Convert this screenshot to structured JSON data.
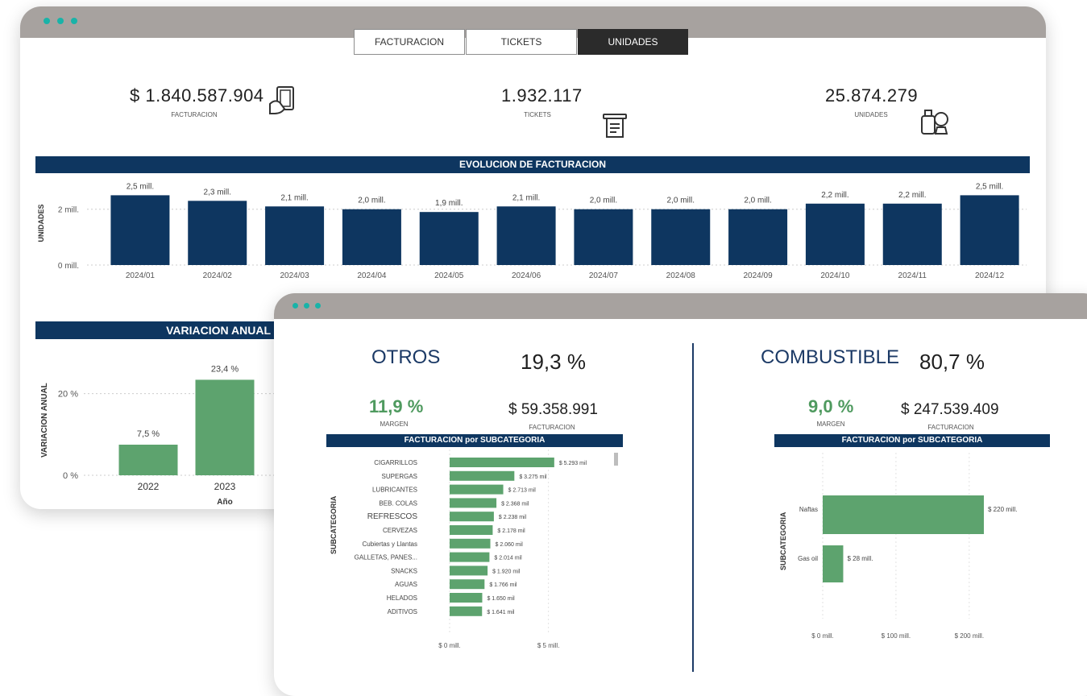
{
  "back_window": {
    "tabs": [
      {
        "label": "FACTURACION",
        "active": false
      },
      {
        "label": "TICKETS",
        "active": false
      },
      {
        "label": "UNIDADES",
        "active": true
      }
    ],
    "kpis": [
      {
        "value": "$ 1.840.587.904",
        "label": "FACTURACION",
        "icon": "hand-money-icon"
      },
      {
        "value": "1.932.117",
        "label": "TICKETS",
        "icon": "receipt-icon"
      },
      {
        "value": "25.874.279",
        "label": "UNIDADES",
        "icon": "products-icon"
      }
    ],
    "evolution_title": "EVOLUCION DE FACTURACION",
    "variation_title": "VARIACION ANUAL"
  },
  "front_window": {
    "left": {
      "name": "OTROS",
      "share": "19,3 %",
      "margin": "11,9 %",
      "margin_label": "MARGEN",
      "billing": "$ 59.358.991",
      "billing_label": "FACTURACION",
      "chart_title": "FACTURACION por SUBCATEGORIA"
    },
    "right": {
      "name": "COMBUSTIBLE",
      "share": "80,7 %",
      "margin": "9,0 %",
      "margin_label": "MARGEN",
      "billing": "$ 247.539.409",
      "billing_label": "FACTURACION",
      "chart_title": "FACTURACION por SUBCATEGORIA"
    }
  },
  "colors": {
    "navy": "#0e3660",
    "green": "#5da36e",
    "titlebar": "#a7a29f",
    "dot": "#19b3a8"
  },
  "chart_data": [
    {
      "type": "bar",
      "title": "EVOLUCION DE FACTURACION",
      "ylabel": "UNIDADES",
      "categories": [
        "2024/01",
        "2024/02",
        "2024/03",
        "2024/04",
        "2024/05",
        "2024/06",
        "2024/07",
        "2024/08",
        "2024/09",
        "2024/10",
        "2024/11",
        "2024/12"
      ],
      "values": [
        2.5,
        2.3,
        2.1,
        2.0,
        1.9,
        2.1,
        2.0,
        2.0,
        2.0,
        2.2,
        2.2,
        2.5
      ],
      "data_labels": [
        "2,5 mill.",
        "2,3 mill.",
        "2,1 mill.",
        "2,0 mill.",
        "1,9 mill.",
        "2,1 mill.",
        "2,0 mill.",
        "2,0 mill.",
        "2,0 mill.",
        "2,2 mill.",
        "2,2 mill.",
        "2,5 mill."
      ],
      "ytick_labels": [
        "0 mill.",
        "2 mill."
      ],
      "ylim": [
        0,
        2.8
      ]
    },
    {
      "type": "bar",
      "title": "VARIACION ANUAL",
      "xlabel": "Año",
      "ylabel": "VARIACION ANUAL",
      "categories": [
        "2022",
        "2023"
      ],
      "values": [
        7.5,
        23.4
      ],
      "data_labels": [
        "7,5 %",
        "23,4 %"
      ],
      "ytick_labels": [
        "0 %",
        "20 %"
      ],
      "ylim": [
        0,
        30
      ]
    },
    {
      "type": "bar",
      "orientation": "horizontal",
      "title": "FACTURACION por SUBCATEGORIA",
      "ylabel": "SUBCATEGORIA",
      "categories": [
        "CIGARRILLOS",
        "SUPERGAS",
        "LUBRICANTES",
        "BEB. COLAS",
        "REFRESCOS",
        "CERVEZAS",
        "Cubiertas y Llantas",
        "GALLETAS, PANES...",
        "SNACKS",
        "AGUAS",
        "HELADOS",
        "ADITIVOS"
      ],
      "values": [
        5.293,
        3.275,
        2.713,
        2.368,
        2.238,
        2.178,
        2.06,
        2.014,
        1.92,
        1.766,
        1.65,
        1.641
      ],
      "data_labels": [
        "$ 5.293 mil",
        "$ 3.275 mil",
        "$ 2.713 mil",
        "$ 2.368 mil",
        "$ 2.238 mil",
        "$ 2.178 mil",
        "$ 2.060 mil",
        "$ 2.014 mil",
        "$ 1.920 mil",
        "$ 1.766 mil",
        "$ 1.650 mil",
        "$ 1.641 mil"
      ],
      "xtick_labels": [
        "$ 0 mill.",
        "$ 5 mill."
      ],
      "xlim": [
        0,
        5.3
      ]
    },
    {
      "type": "bar",
      "orientation": "horizontal",
      "title": "FACTURACION por SUBCATEGORIA",
      "ylabel": "SUBCATEGORIA",
      "categories": [
        "Naftas",
        "Gas oil"
      ],
      "values": [
        220,
        28
      ],
      "data_labels": [
        "$ 220 mill.",
        "$ 28 mill."
      ],
      "xtick_labels": [
        "$ 0 mill.",
        "$ 100 mill.",
        "$ 200 mill."
      ],
      "xlim": [
        0,
        220
      ]
    }
  ]
}
